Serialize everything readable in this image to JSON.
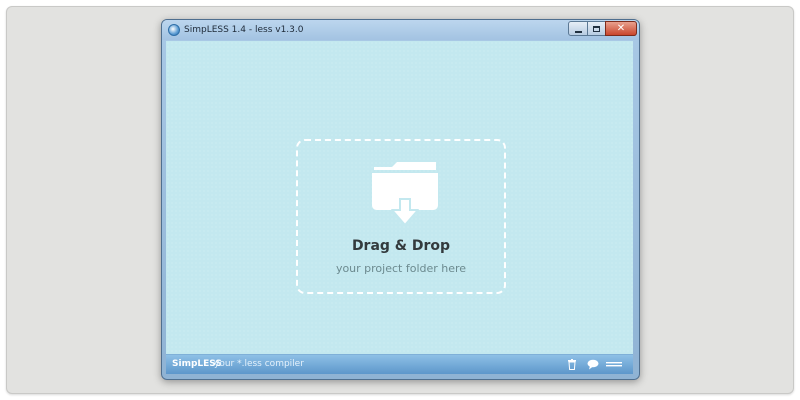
{
  "window": {
    "title": "SimpLESS 1.4 - less v1.3.0",
    "close_glyph": "✕"
  },
  "dropzone": {
    "title": "Drag & Drop",
    "subtitle": "your project folder here"
  },
  "statusbar": {
    "brand": "SimpLESS",
    "tagline": "your *.less compiler"
  },
  "icons": {
    "app": "simpless-app-icon",
    "folder": "folder-download-icon",
    "trash": "trash-icon",
    "chat": "chat-bubble-icon",
    "menu": "menu-icon"
  },
  "colors": {
    "client_background": "#c3e8ef",
    "dropzone_border": "#ffffff",
    "statusbar": "#5d97cb"
  }
}
